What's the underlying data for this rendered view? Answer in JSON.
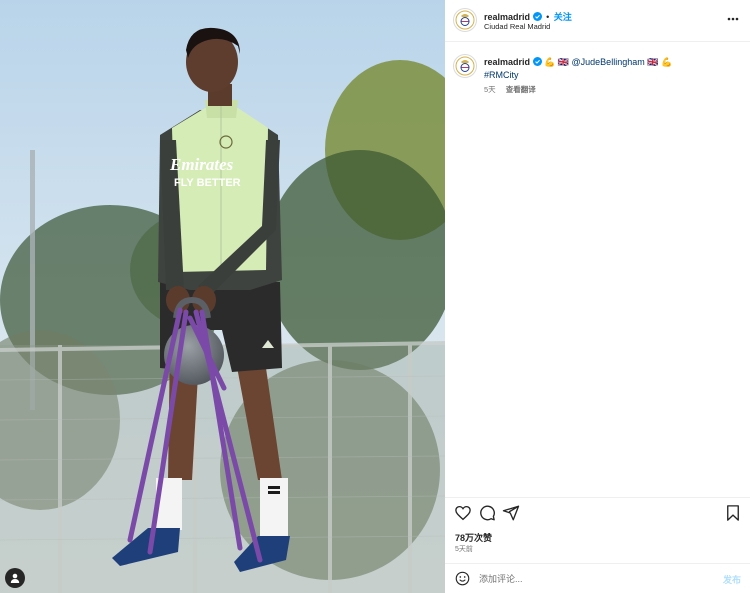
{
  "post": {
    "username": "realmadrid",
    "follow_label": "关注",
    "location": "Ciudad Real Madrid",
    "more_label": "更多选项"
  },
  "caption": {
    "username": "realmadrid",
    "emoji_flex": "💪",
    "emoji_flag": "🇬🇧",
    "mention": "@JudeBellingham",
    "hashtag": "#RMCity",
    "time": "5天",
    "translate_label": "查看翻译"
  },
  "stats": {
    "likes": "78万次赞",
    "time_ago": "5天前"
  },
  "comment": {
    "placeholder": "添加评论...",
    "post_label": "发布"
  },
  "photo": {
    "jersey_text_1": "Emirates",
    "jersey_text_2": "FLY BETTER"
  },
  "icons": {
    "like": "heart-icon",
    "comment": "speech-bubble-icon",
    "share": "paper-plane-icon",
    "save": "bookmark-icon",
    "emoji": "smiley-icon",
    "more": "ellipsis-icon",
    "verified": "verified-badge-icon",
    "user_tag": "user-tag-icon"
  },
  "colors": {
    "accent": "#0095f6",
    "link": "#00376b",
    "verified": "#0095f6",
    "post_disabled": "#b2dffc",
    "resistance_band": "#7b4aa8",
    "jersey": "#d5ecb6"
  }
}
